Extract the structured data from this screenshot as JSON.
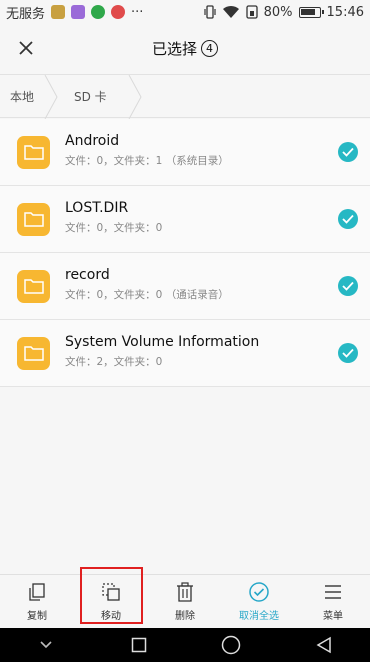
{
  "status_bar": {
    "carrier": "无服务",
    "battery": "80%",
    "time": "15:46",
    "more": "···"
  },
  "header": {
    "title": "已选择",
    "selected_count": "4"
  },
  "breadcrumb": [
    {
      "label": "本地"
    },
    {
      "label": "SD 卡"
    }
  ],
  "files": [
    {
      "name": "Android",
      "meta": "文件：0，文件夹：1   （系统目录）"
    },
    {
      "name": "LOST.DIR",
      "meta": "文件：0，文件夹：0"
    },
    {
      "name": "record",
      "meta": "文件：0，文件夹：0   （通话录音）"
    },
    {
      "name": "System Volume Information",
      "meta": "文件：2，文件夹：0"
    }
  ],
  "toolbar": {
    "copy": "复制",
    "move": "移动",
    "delete": "删除",
    "deselect_all": "取消全选",
    "menu": "菜单"
  },
  "colors": {
    "accent": "#27a7c8",
    "check": "#26b8c4",
    "folder": "#f7b731",
    "highlight": "#e02020"
  }
}
